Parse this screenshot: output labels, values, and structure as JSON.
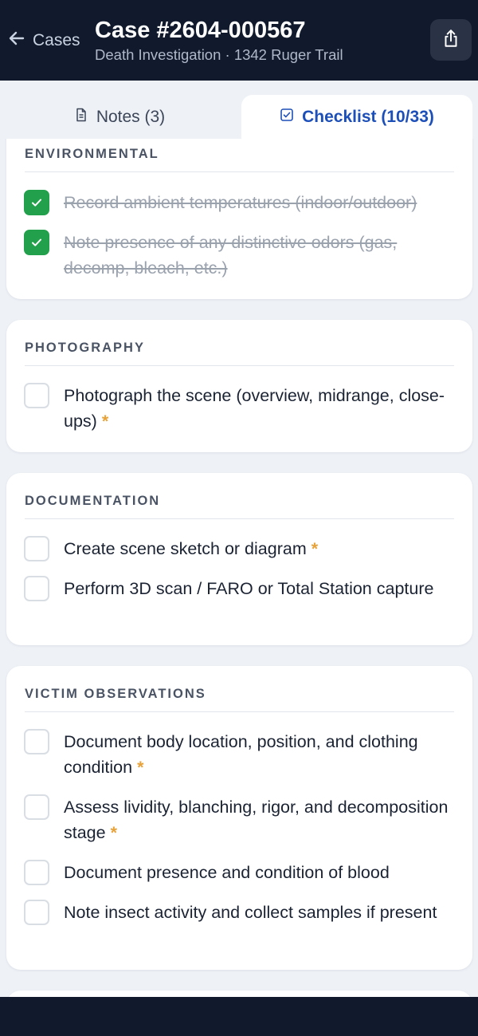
{
  "header": {
    "back_label": "Cases",
    "title": "Case #2604-000567",
    "subtitle": "Death Investigation · 1342 Ruger Trail"
  },
  "tabs": {
    "notes_label": "Notes (3)",
    "checklist_label": "Checklist (10/33)"
  },
  "sections": {
    "environmental": {
      "title": "ENVIRONMENTAL",
      "items": [
        {
          "label": "Record ambient temperatures (indoor/outdoor)",
          "checked": true
        },
        {
          "label": "Note presence of any distinctive odors (gas, decomp, bleach, etc.)",
          "checked": true
        }
      ]
    },
    "photography": {
      "title": "PHOTOGRAPHY",
      "items": [
        {
          "label": "Photograph the scene (overview, midrange, close-ups)",
          "required_mark": "*",
          "checked": false
        }
      ]
    },
    "documentation": {
      "title": "DOCUMENTATION",
      "items": [
        {
          "label": "Create scene sketch or diagram",
          "required_mark": "*",
          "checked": false
        },
        {
          "label": "Perform 3D scan / FARO or Total Station capture",
          "checked": false
        }
      ]
    },
    "victim": {
      "title": "VICTIM OBSERVATIONS",
      "items": [
        {
          "label": "Document body location, position, and clothing condition",
          "required_mark": "*",
          "checked": false
        },
        {
          "label": "Assess lividity, blanching, rigor, and decomposition stage",
          "required_mark": "*",
          "checked": false
        },
        {
          "label": "Document presence and condition of blood",
          "checked": false
        },
        {
          "label": "Note insect activity and collect samples if present",
          "checked": false
        }
      ]
    }
  },
  "colors": {
    "header_bg": "#111a2c",
    "accent": "#1d4fb8",
    "check_green": "#22a04b",
    "required": "#e8a23a"
  },
  "icons": {
    "back": "arrow-left-icon",
    "share": "share-icon",
    "notes": "document-icon",
    "checklist": "checkbox-icon",
    "check": "checkmark-icon"
  }
}
